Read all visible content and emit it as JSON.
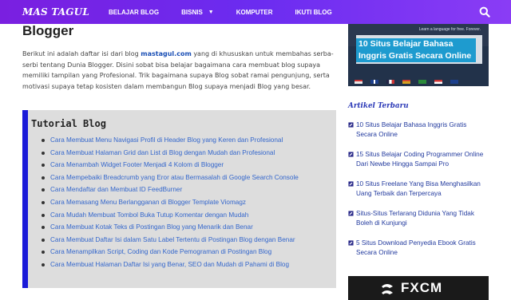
{
  "navbar": {
    "logo": "MAS TAGUL",
    "items": [
      {
        "label": "BELAJAR BLOG"
      },
      {
        "label": "BISNIS",
        "has_dropdown": true
      },
      {
        "label": "KOMPUTER"
      },
      {
        "label": "IKUTI BLOG"
      }
    ],
    "background": "#7a1fe0"
  },
  "main": {
    "title": "Blogger",
    "intro_before": "Berikut ini adalah daftar isi dari blog ",
    "intro_link": "mastagul.com",
    "intro_after": " yang di khususkan untuk membahas serba-serbi tentang Dunia Blogger. Disini sobat bisa belajar bagaimana cara membuat blog supaya memiliki tampilan yang Profesional. Trik bagaimana supaya Blog sobat ramai pengunjung, serta motivasi supaya tetap kosisten dalam membangun Blog supaya menjadi Blog yang besar.",
    "tutorial": {
      "title": "Tutorial Blog",
      "items": [
        "Cara Membuat Menu Navigasi Profil di Header Blog yang Keren dan Profesional",
        "Cara Membuat Halaman Grid dan List di Blog dengan Mudah dan Profesional",
        "Cara Menambah Widget Footer Menjadi 4 Kolom di Blogger",
        "Cara Mempebaiki Breadcrumb yang Eror atau Bermasalah di Google Search Console",
        "Cara Mendaftar dan Membuat ID FeedBurner",
        "Cara Memasang Menu Berlangganan di Blogger Template Viomagz",
        "Cara Mudah Membuat Tombol Buka Tutup Komentar dengan Mudah",
        "Cara Membuat Kotak Teks di Postingan Blog yang Menarik dan Benar",
        "Cara Membuat Daftar Isi dalam Satu Label Tertentu di Postingan Blog dengan Benar",
        "Cara Menampilkan Script, Coding dan Kode Pemograman di Postingan Blog",
        "Cara Membuat Halaman Daftar Isi yang Benar, SEO dan Mudah di Pahami di Blog"
      ],
      "accent": "#1a1ad8"
    }
  },
  "sidebar": {
    "banner": {
      "small_text": "Learn a language for free. Forever.",
      "title": "10 Situs Belajar Bahasa Inggris Gratis Secara Online"
    },
    "section_title": "Artikel Terbaru",
    "articles": [
      "10 Situs Belajar Bahasa Inggris Gratis Secara Online",
      "15 Situs Belajar Coding Programmer Online Dari Newbe Hingga Sampai Pro",
      "10 Situs Freelane Yang Bisa Menghasilkan Uang Terbaik dan Terpercaya",
      "Situs-Situs Terlarang Didunia Yang Tidak Boleh di Kunjungi",
      "5 Situs Download Penyedia Ebook Gratis Secara Online"
    ],
    "ad_text": "FXCM"
  }
}
